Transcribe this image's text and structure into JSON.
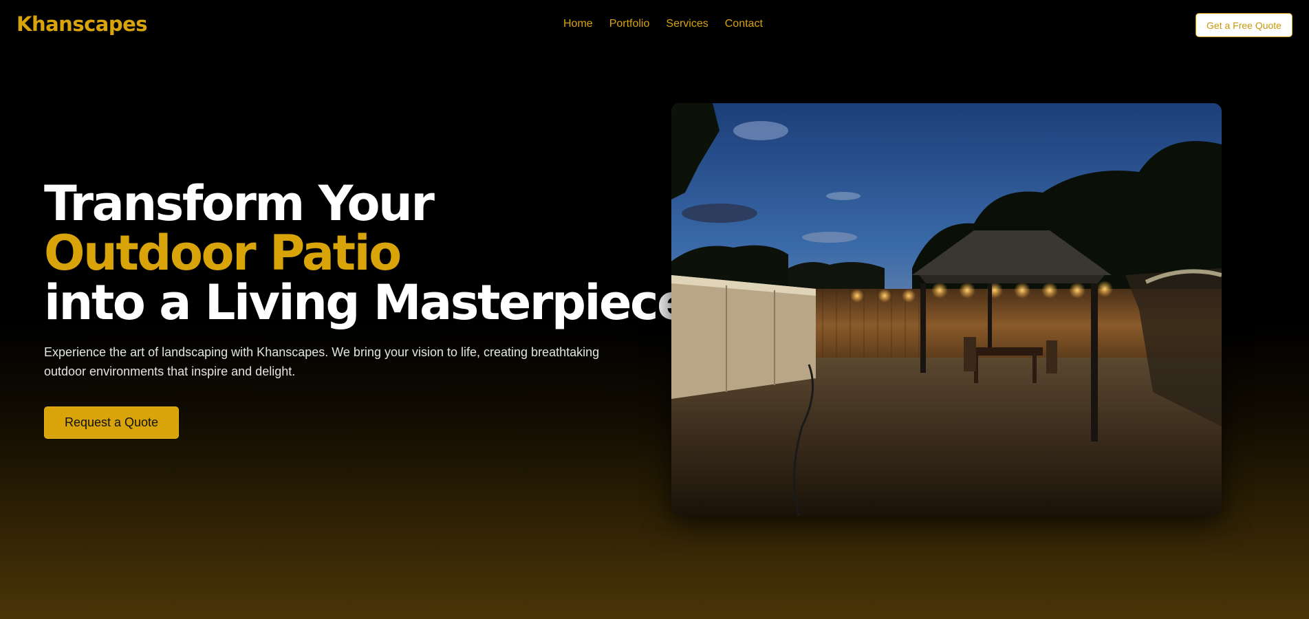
{
  "brand": {
    "name": "Khanscapes"
  },
  "nav": {
    "links": [
      "Home",
      "Portfolio",
      "Services",
      "Contact"
    ],
    "cta_label": "Get a Free Quote"
  },
  "hero": {
    "headline_line1": "Transform Your",
    "headline_line2": "Outdoor Patio",
    "headline_line3": "into a Living Masterpiece",
    "description": "Experience the art of landscaping with Khanscapes. We bring your vision to life, creating breathtaking outdoor environments that inspire and delight.",
    "cta_label": "Request a Quote"
  },
  "colors": {
    "accent": "#d9a40a",
    "background": "#000000",
    "text": "#ffffff"
  }
}
